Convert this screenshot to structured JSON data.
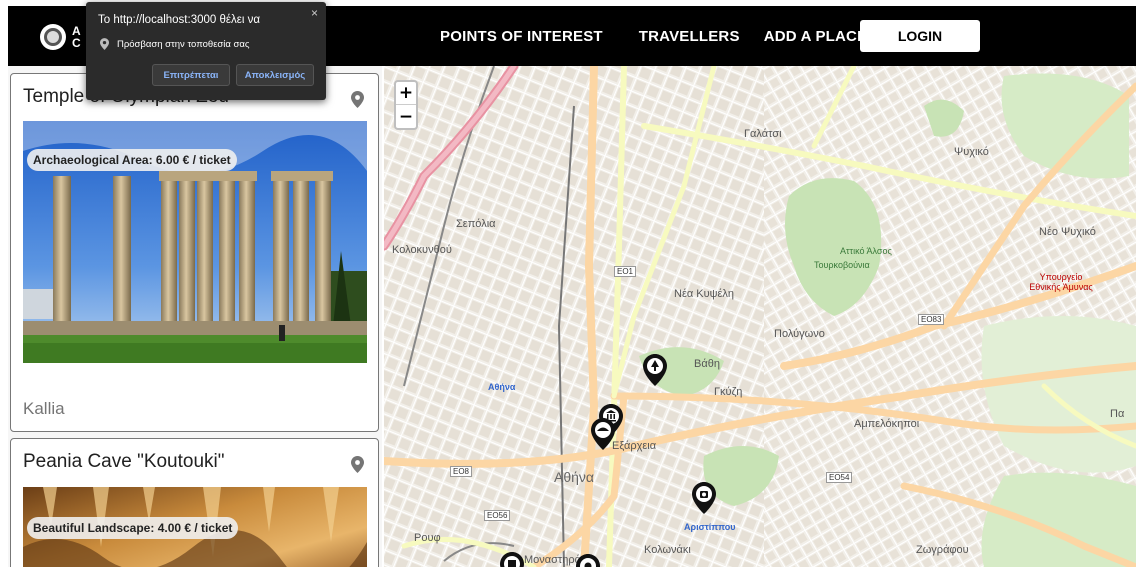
{
  "navbar": {
    "brand_line1": "A",
    "brand_line2": "C",
    "links": [
      "POINTS OF INTEREST",
      "TRAVELLERS",
      "ADD A PLACE"
    ],
    "login_label": "LOGIN"
  },
  "permission_popup": {
    "title": "Το http://localhost:3000 θέλει να",
    "request": "Πρόσβαση στην τοποθεσία σας",
    "allow_label": "Επιτρέπεται",
    "block_label": "Αποκλεισμός",
    "close_glyph": "×"
  },
  "cards": [
    {
      "title": "Temple of Olympian Zeu",
      "price_badge": "Archaeological Area: 6.00 € / ticket",
      "author": "Kallia"
    },
    {
      "title": "Peania Cave \"Koutouki\"",
      "price_badge": "Beautiful Landscape: 4.00 € / ticket"
    }
  ],
  "map": {
    "zoom_in": "+",
    "zoom_out": "−",
    "labels": {
      "athina": "Αθήνα",
      "galatsi": "Γαλάτσι",
      "psychiko": "Ψυχικό",
      "neo_psychiko": "Νέο Ψυχικό",
      "nea_kypseli": "Νέα Κυψέλη",
      "polygono": "Πολύγωνο",
      "gkyzi": "Γκύζη",
      "ampelokipoi": "Αμπελόκηποι",
      "exarcheia": "Εξάρχεια",
      "kolonaki": "Κολωνάκι",
      "sepolia": "Σεπόλια",
      "kolokynthou": "Κολοκυνθού",
      "zografou": "Ζωγράφου",
      "rouf": "Ρουφ",
      "aristippou": "Αριστίππου",
      "tourkovounia": "Τουρκοβούνια",
      "attiko_alsos": "Αττικό Άλσος",
      "ypourgeio": "Υπουργείο Εθνικής Άμυνας",
      "pa": "Πα",
      "monastiraki": "Μοναστηράκ",
      "athina_blue": "Αθήνα",
      "vathi": "Βάθη"
    },
    "road_shields": [
      "ΕΟ1",
      "ΕΟ8",
      "ΕΟ83",
      "ΕΟ54",
      "ΕΟ56"
    ]
  }
}
